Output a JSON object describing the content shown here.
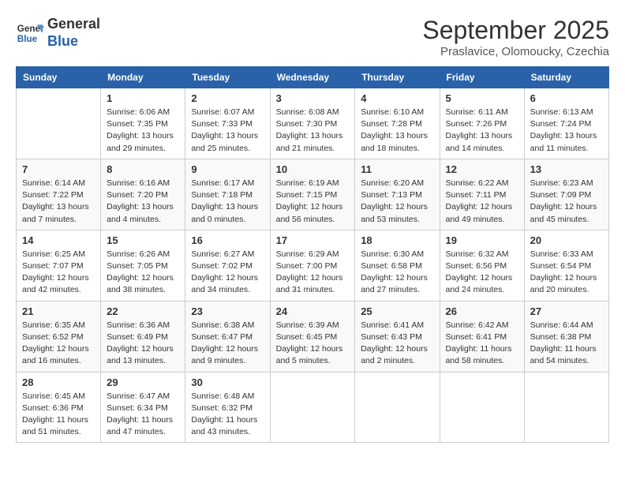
{
  "header": {
    "logo_line1": "General",
    "logo_line2": "Blue",
    "month": "September 2025",
    "location": "Praslavice, Olomoucky, Czechia"
  },
  "days_of_week": [
    "Sunday",
    "Monday",
    "Tuesday",
    "Wednesday",
    "Thursday",
    "Friday",
    "Saturday"
  ],
  "weeks": [
    [
      {
        "day": "",
        "info": ""
      },
      {
        "day": "1",
        "info": "Sunrise: 6:06 AM\nSunset: 7:35 PM\nDaylight: 13 hours\nand 29 minutes."
      },
      {
        "day": "2",
        "info": "Sunrise: 6:07 AM\nSunset: 7:33 PM\nDaylight: 13 hours\nand 25 minutes."
      },
      {
        "day": "3",
        "info": "Sunrise: 6:08 AM\nSunset: 7:30 PM\nDaylight: 13 hours\nand 21 minutes."
      },
      {
        "day": "4",
        "info": "Sunrise: 6:10 AM\nSunset: 7:28 PM\nDaylight: 13 hours\nand 18 minutes."
      },
      {
        "day": "5",
        "info": "Sunrise: 6:11 AM\nSunset: 7:26 PM\nDaylight: 13 hours\nand 14 minutes."
      },
      {
        "day": "6",
        "info": "Sunrise: 6:13 AM\nSunset: 7:24 PM\nDaylight: 13 hours\nand 11 minutes."
      }
    ],
    [
      {
        "day": "7",
        "info": "Sunrise: 6:14 AM\nSunset: 7:22 PM\nDaylight: 13 hours\nand 7 minutes."
      },
      {
        "day": "8",
        "info": "Sunrise: 6:16 AM\nSunset: 7:20 PM\nDaylight: 13 hours\nand 4 minutes."
      },
      {
        "day": "9",
        "info": "Sunrise: 6:17 AM\nSunset: 7:18 PM\nDaylight: 13 hours\nand 0 minutes."
      },
      {
        "day": "10",
        "info": "Sunrise: 6:19 AM\nSunset: 7:15 PM\nDaylight: 12 hours\nand 56 minutes."
      },
      {
        "day": "11",
        "info": "Sunrise: 6:20 AM\nSunset: 7:13 PM\nDaylight: 12 hours\nand 53 minutes."
      },
      {
        "day": "12",
        "info": "Sunrise: 6:22 AM\nSunset: 7:11 PM\nDaylight: 12 hours\nand 49 minutes."
      },
      {
        "day": "13",
        "info": "Sunrise: 6:23 AM\nSunset: 7:09 PM\nDaylight: 12 hours\nand 45 minutes."
      }
    ],
    [
      {
        "day": "14",
        "info": "Sunrise: 6:25 AM\nSunset: 7:07 PM\nDaylight: 12 hours\nand 42 minutes."
      },
      {
        "day": "15",
        "info": "Sunrise: 6:26 AM\nSunset: 7:05 PM\nDaylight: 12 hours\nand 38 minutes."
      },
      {
        "day": "16",
        "info": "Sunrise: 6:27 AM\nSunset: 7:02 PM\nDaylight: 12 hours\nand 34 minutes."
      },
      {
        "day": "17",
        "info": "Sunrise: 6:29 AM\nSunset: 7:00 PM\nDaylight: 12 hours\nand 31 minutes."
      },
      {
        "day": "18",
        "info": "Sunrise: 6:30 AM\nSunset: 6:58 PM\nDaylight: 12 hours\nand 27 minutes."
      },
      {
        "day": "19",
        "info": "Sunrise: 6:32 AM\nSunset: 6:56 PM\nDaylight: 12 hours\nand 24 minutes."
      },
      {
        "day": "20",
        "info": "Sunrise: 6:33 AM\nSunset: 6:54 PM\nDaylight: 12 hours\nand 20 minutes."
      }
    ],
    [
      {
        "day": "21",
        "info": "Sunrise: 6:35 AM\nSunset: 6:52 PM\nDaylight: 12 hours\nand 16 minutes."
      },
      {
        "day": "22",
        "info": "Sunrise: 6:36 AM\nSunset: 6:49 PM\nDaylight: 12 hours\nand 13 minutes."
      },
      {
        "day": "23",
        "info": "Sunrise: 6:38 AM\nSunset: 6:47 PM\nDaylight: 12 hours\nand 9 minutes."
      },
      {
        "day": "24",
        "info": "Sunrise: 6:39 AM\nSunset: 6:45 PM\nDaylight: 12 hours\nand 5 minutes."
      },
      {
        "day": "25",
        "info": "Sunrise: 6:41 AM\nSunset: 6:43 PM\nDaylight: 12 hours\nand 2 minutes."
      },
      {
        "day": "26",
        "info": "Sunrise: 6:42 AM\nSunset: 6:41 PM\nDaylight: 11 hours\nand 58 minutes."
      },
      {
        "day": "27",
        "info": "Sunrise: 6:44 AM\nSunset: 6:38 PM\nDaylight: 11 hours\nand 54 minutes."
      }
    ],
    [
      {
        "day": "28",
        "info": "Sunrise: 6:45 AM\nSunset: 6:36 PM\nDaylight: 11 hours\nand 51 minutes."
      },
      {
        "day": "29",
        "info": "Sunrise: 6:47 AM\nSunset: 6:34 PM\nDaylight: 11 hours\nand 47 minutes."
      },
      {
        "day": "30",
        "info": "Sunrise: 6:48 AM\nSunset: 6:32 PM\nDaylight: 11 hours\nand 43 minutes."
      },
      {
        "day": "",
        "info": ""
      },
      {
        "day": "",
        "info": ""
      },
      {
        "day": "",
        "info": ""
      },
      {
        "day": "",
        "info": ""
      }
    ]
  ]
}
